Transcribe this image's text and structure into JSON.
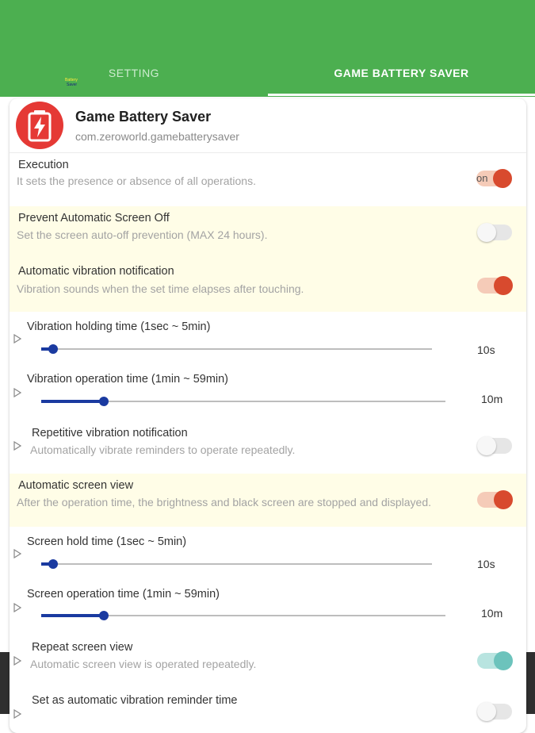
{
  "tabs": [
    {
      "label": "SETTING",
      "active": false
    },
    {
      "label": "GAME BATTERY SAVER",
      "active": true
    }
  ],
  "tiny_logo": {
    "line1": "Battery",
    "line2": "Saver"
  },
  "app": {
    "title": "Game Battery Saver",
    "package": "com.zeroworld.gamebatterysaver",
    "icon": "battery-charging-icon"
  },
  "settings": [
    {
      "title": "Execution",
      "desc": "It sets the presence or absence of all operations.",
      "toggle": "on",
      "toggle_label": "on"
    },
    {
      "title": "Prevent Automatic Screen Off",
      "desc": "Set the screen auto-off prevention (MAX 24 hours).",
      "toggle": "off"
    },
    {
      "title": "Automatic vibration notification",
      "desc": "Vibration sounds when the set time elapses after touching.",
      "toggle": "on"
    },
    {
      "title": "Vibration holding time (1sec ~ 5min)",
      "value": "10s",
      "fraction": 0.03
    },
    {
      "title": "Vibration operation time (1min ~ 59min)",
      "value": "10m",
      "fraction": 0.155
    },
    {
      "title": "Repetitive vibration notification",
      "desc": "Automatically vibrate reminders to operate repeatedly.",
      "toggle": "off"
    },
    {
      "title": "Automatic screen view",
      "desc": "After the operation time, the brightness and black screen are stopped and displayed.",
      "toggle": "on"
    },
    {
      "title": "Screen hold time (1sec ~ 5min)",
      "value": "10s",
      "fraction": 0.03
    },
    {
      "title": "Screen operation time (1min ~ 59min)",
      "value": "10m",
      "fraction": 0.155
    },
    {
      "title": "Repeat screen view",
      "desc": "Automatic screen view is operated repeatedly.",
      "toggle": "on"
    },
    {
      "title": "Set as automatic vibration reminder time",
      "toggle": "off"
    }
  ],
  "colors": {
    "primary": "#4caf50",
    "accent_on": "#d84a2e",
    "teal_on": "#6cc3bc",
    "slider": "#1a3aa0",
    "highlight": "#fffde7"
  }
}
